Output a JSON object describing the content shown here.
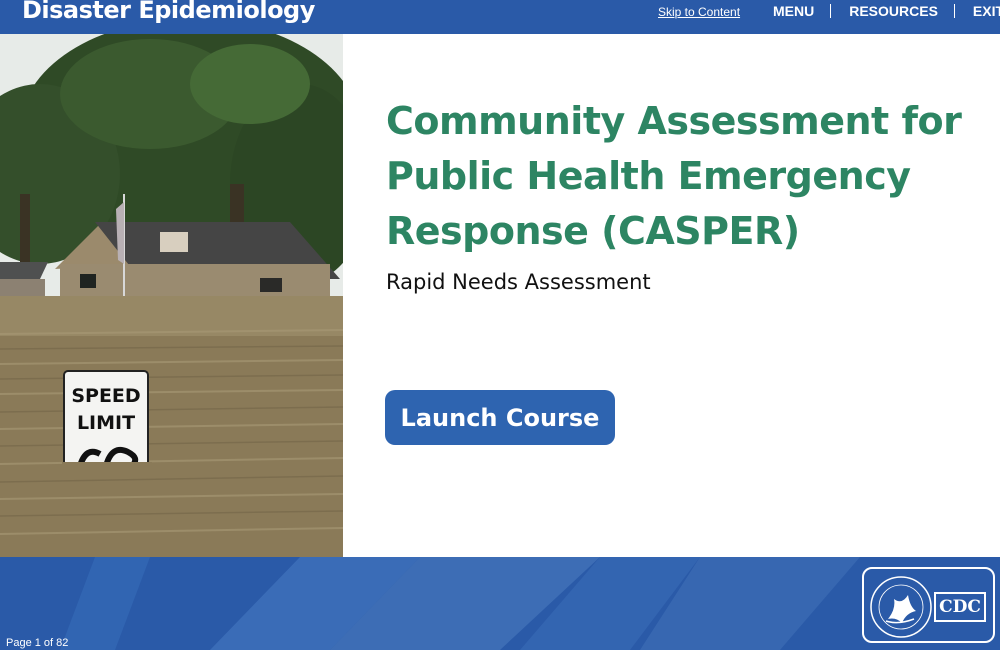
{
  "header": {
    "app_title": "Disaster Epidemiology",
    "skip_link": "Skip to Content",
    "nav": [
      "MENU",
      "RESOURCES",
      "EXIT"
    ]
  },
  "photo": {
    "sign_line1": "SPEED",
    "sign_line2": "LIMIT"
  },
  "main": {
    "title_lines": [
      "Community Assessment for",
      "Public Health Emergency",
      "Response (CASPER)"
    ],
    "subtitle": "Rapid Needs Assessment",
    "launch_label": "Launch Course"
  },
  "footer": {
    "page_indicator": "Page 1 of 82",
    "logo_text": "CDC"
  },
  "colors": {
    "brand_blue": "#2a5aa8",
    "title_green": "#2d8563",
    "button_blue": "#2e64b0"
  }
}
